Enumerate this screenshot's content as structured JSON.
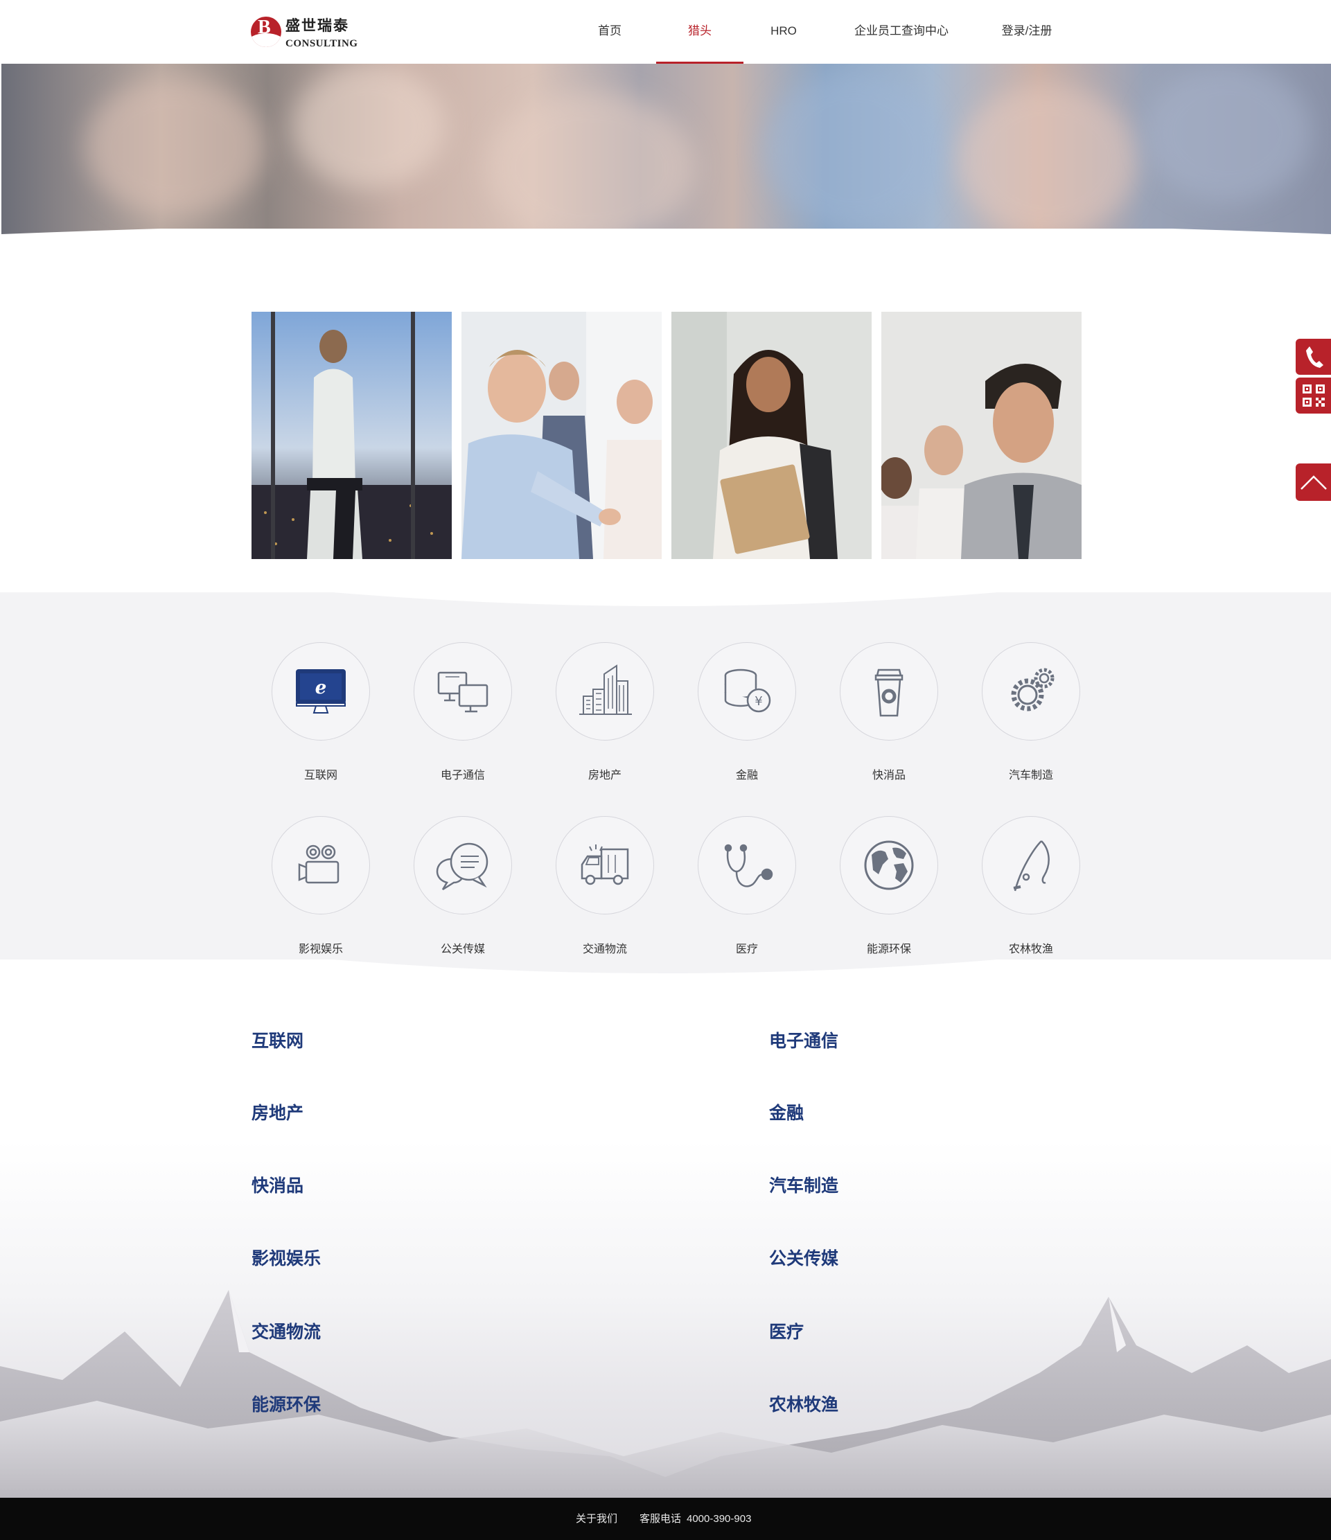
{
  "brand": {
    "name_cn": "盛世瑞泰",
    "name_en": "CONSULTING",
    "mark_letter": "B",
    "accent_color": "#b8222a",
    "heading_color": "#1f3a7a"
  },
  "nav": {
    "items": [
      {
        "label": "首页",
        "active": false
      },
      {
        "label": "猎头",
        "active": true
      },
      {
        "label": "HRO",
        "active": false
      },
      {
        "label": "企业员工查询中心",
        "active": false
      },
      {
        "label": "登录/注册",
        "active": false
      }
    ]
  },
  "photos": [
    {
      "name": "woman-window-city"
    },
    {
      "name": "team-pointing"
    },
    {
      "name": "student-with-folder"
    },
    {
      "name": "business-team-smiling"
    }
  ],
  "industries": [
    {
      "label": "互联网",
      "icon": "internet-monitor-icon"
    },
    {
      "label": "电子通信",
      "icon": "computers-icon"
    },
    {
      "label": "房地产",
      "icon": "buildings-icon"
    },
    {
      "label": "金融",
      "icon": "coins-yen-icon"
    },
    {
      "label": "快消品",
      "icon": "coffee-cup-icon"
    },
    {
      "label": "汽车制造",
      "icon": "gears-icon"
    },
    {
      "label": "影视娱乐",
      "icon": "film-camera-icon"
    },
    {
      "label": "公关传媒",
      "icon": "chat-bubbles-icon"
    },
    {
      "label": "交通物流",
      "icon": "truck-icon"
    },
    {
      "label": "医疗",
      "icon": "stethoscope-icon"
    },
    {
      "label": "能源环保",
      "icon": "globe-icon"
    },
    {
      "label": "农林牧渔",
      "icon": "fishing-rod-icon"
    }
  ],
  "headings": [
    "互联网",
    "电子通信",
    "房地产",
    "金融",
    "快消品",
    "汽车制造",
    "影视娱乐",
    "公关传媒",
    "交通物流",
    "医疗",
    "能源环保",
    "农林牧渔"
  ],
  "footer": {
    "about": "关于我们",
    "phone_label": "客服电话",
    "phone": "4000-390-903"
  },
  "side_tools": [
    {
      "icon": "phone-icon"
    },
    {
      "icon": "qrcode-icon"
    },
    {
      "icon": "back-to-top-icon"
    }
  ]
}
